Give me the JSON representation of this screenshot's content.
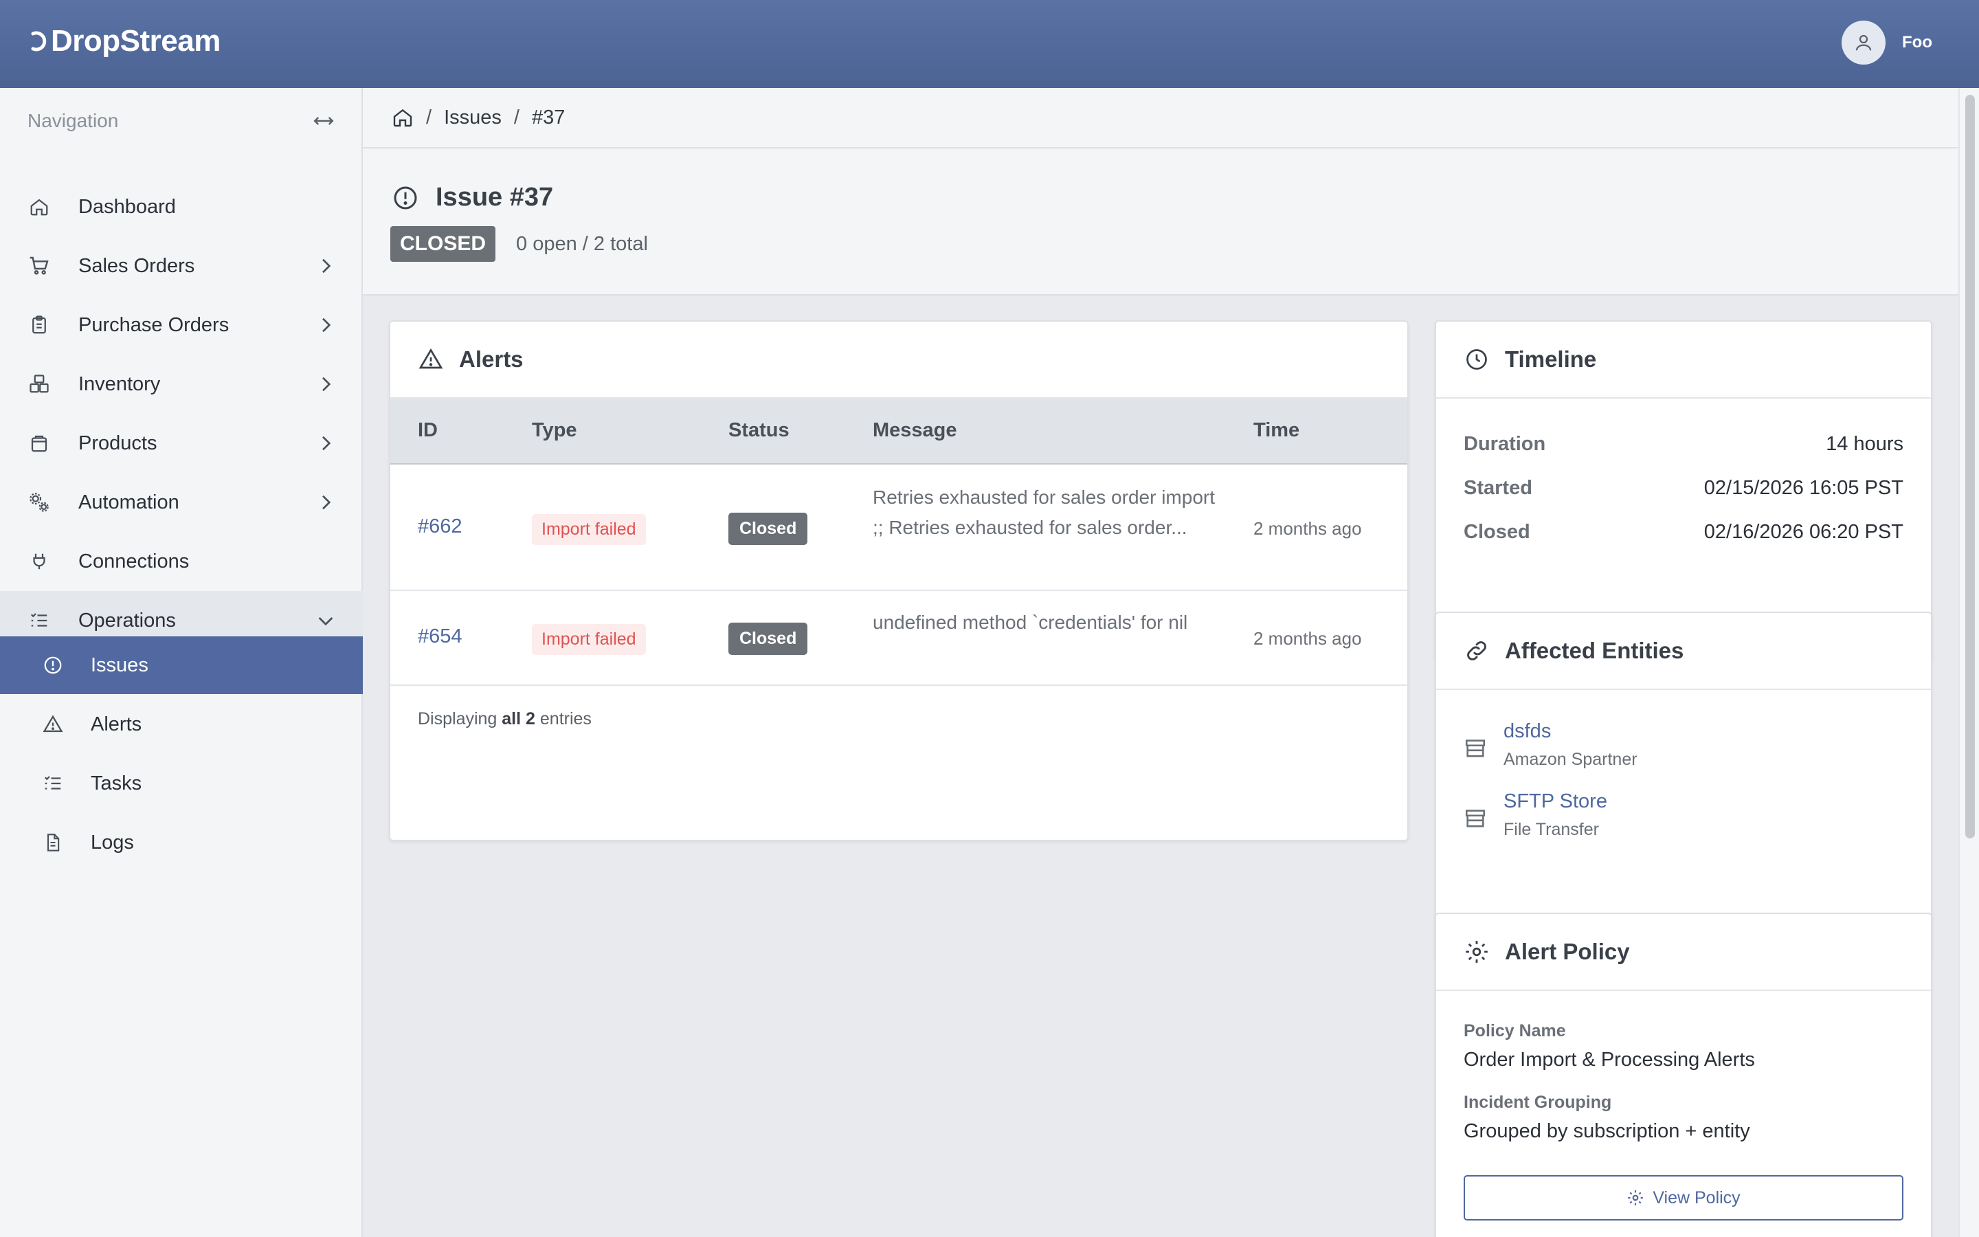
{
  "app": {
    "name": "DropStream"
  },
  "user": {
    "name": "Foo"
  },
  "nav": {
    "heading": "Navigation",
    "items": [
      {
        "label": "Dashboard"
      },
      {
        "label": "Sales Orders"
      },
      {
        "label": "Purchase Orders"
      },
      {
        "label": "Inventory"
      },
      {
        "label": "Products"
      },
      {
        "label": "Automation"
      },
      {
        "label": "Connections"
      },
      {
        "label": "Operations"
      }
    ],
    "subitems": [
      {
        "label": "Issues"
      },
      {
        "label": "Alerts"
      },
      {
        "label": "Tasks"
      },
      {
        "label": "Logs"
      }
    ]
  },
  "breadcrumb": {
    "section": "Issues",
    "current": "#37"
  },
  "issue": {
    "title": "Issue #37",
    "status": "CLOSED",
    "counts": "0 open / 2 total"
  },
  "alerts": {
    "title": "Alerts",
    "columns": [
      "ID",
      "Type",
      "Status",
      "Message",
      "Time"
    ],
    "rows": [
      {
        "id": "#662",
        "type": "Import failed",
        "status": "Closed",
        "message": "Retries exhausted for sales order import ;; Retries exhausted for sales order...",
        "time": "2 months ago"
      },
      {
        "id": "#654",
        "type": "Import failed",
        "status": "Closed",
        "message": "undefined method `credentials' for nil",
        "time": "2 months ago"
      }
    ],
    "footer": {
      "prefix": "Displaying ",
      "bold": "all 2",
      "suffix": " entries"
    }
  },
  "timeline": {
    "title": "Timeline",
    "rows": [
      {
        "label": "Duration",
        "value": "14 hours"
      },
      {
        "label": "Started",
        "value": "02/15/2026 16:05 PST"
      },
      {
        "label": "Closed",
        "value": "02/16/2026 06:20 PST"
      }
    ]
  },
  "entities": {
    "title": "Affected Entities",
    "items": [
      {
        "name": "dsfds",
        "sub": "Amazon Spartner"
      },
      {
        "name": "SFTP Store",
        "sub": "File Transfer"
      }
    ]
  },
  "policy": {
    "title": "Alert Policy",
    "name_label": "Policy Name",
    "name_value": "Order Import & Processing Alerts",
    "grouping_label": "Incident Grouping",
    "grouping_value": "Grouped by subscription + entity",
    "button_label": "View Policy"
  },
  "colors": {
    "header": "#5a73a4",
    "accent": "#4f68a0",
    "active_nav": "#5169a0",
    "closed_badge": "#6b7076",
    "error_text": "#e05252"
  }
}
